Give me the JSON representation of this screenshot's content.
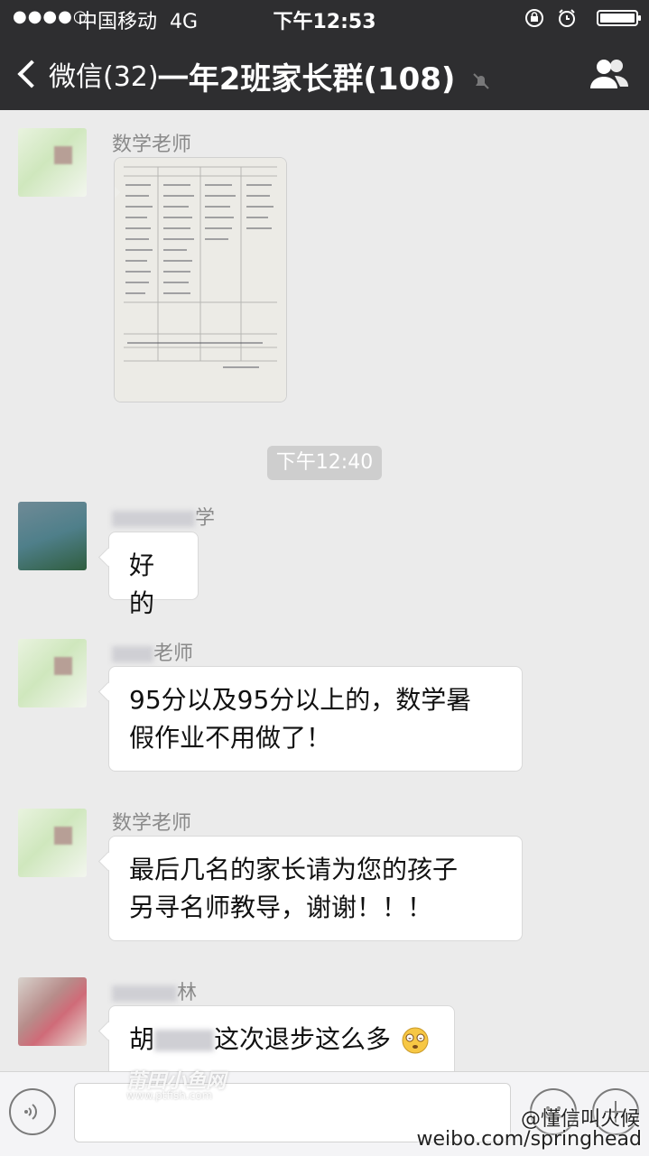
{
  "status_bar": {
    "signal": "●●●●○",
    "carrier": "中国移动",
    "network": "4G",
    "time": "下午12:53"
  },
  "header": {
    "back_label": "微信(32)",
    "title": "一年2班家长群(108)"
  },
  "messages": [
    {
      "sender": "数学老师",
      "type": "image"
    },
    {
      "type": "timestamp",
      "text": "下午12:40"
    },
    {
      "sender_visible": "学",
      "text": "好的"
    },
    {
      "sender_visible": "老师",
      "text_line1": "95分以及95分以上的，数学暑",
      "text_line2": "假作业不用做了！"
    },
    {
      "sender": "数学老师",
      "text_line1": "最后几名的家长请为您的孩子",
      "text_line2": "另寻名师教导，谢谢！！！"
    },
    {
      "sender_visible": "林",
      "text_start": "胡",
      "text_end": "这次退步这么多"
    }
  ],
  "watermarks": {
    "site_cn": "莆田小鱼网",
    "site_url": "www.ptfish.com",
    "weibo_name": "@懂信叫火候",
    "weibo_url": "weibo.com/springhead"
  }
}
